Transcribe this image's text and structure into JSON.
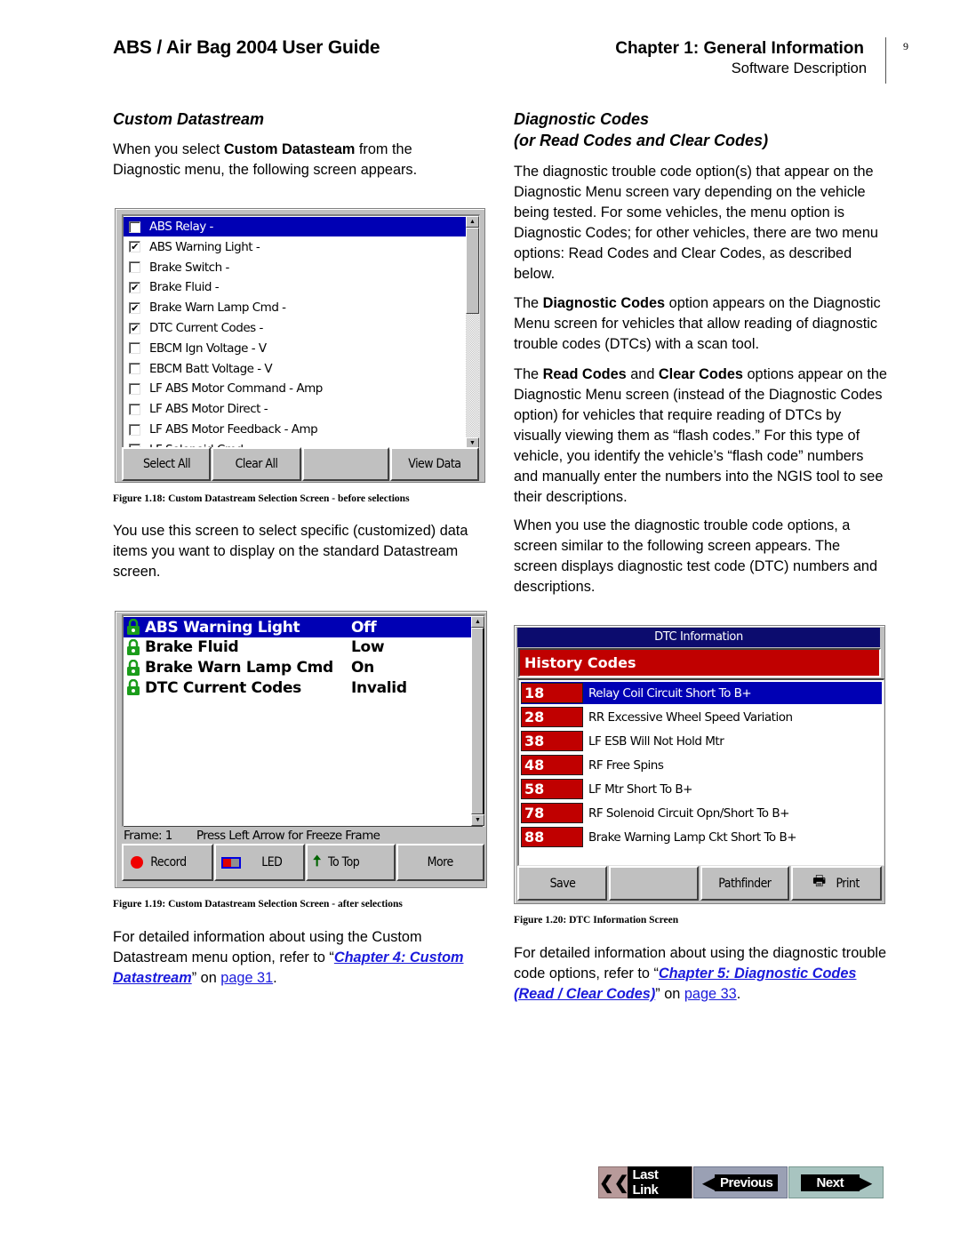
{
  "header": {
    "doc_title": "ABS / Air Bag 2004 User Guide",
    "chapter_title": "Chapter 1: General Information",
    "chapter_subtitle": "Software Description",
    "page_number": "9"
  },
  "left": {
    "heading": "Custom Datastream",
    "intro_pre": "When you select ",
    "intro_bold": "Custom Datasteam",
    "intro_post": " from the Diagnostic menu, the following screen appears.",
    "fig1": {
      "items": [
        {
          "label": "ABS Relay -",
          "checked": false,
          "selected": true
        },
        {
          "label": "ABS Warning Light -",
          "checked": true,
          "selected": false
        },
        {
          "label": "Brake Switch -",
          "checked": false,
          "selected": false
        },
        {
          "label": "Brake Fluid -",
          "checked": true,
          "selected": false
        },
        {
          "label": "Brake Warn Lamp Cmd -",
          "checked": true,
          "selected": false
        },
        {
          "label": "DTC Current Codes -",
          "checked": true,
          "selected": false
        },
        {
          "label": "EBCM Ign Voltage - V",
          "checked": false,
          "selected": false
        },
        {
          "label": "EBCM Batt Voltage - V",
          "checked": false,
          "selected": false
        },
        {
          "label": "LF ABS Motor Command - Amp",
          "checked": false,
          "selected": false
        },
        {
          "label": "LF ABS Motor Direct -",
          "checked": false,
          "selected": false
        },
        {
          "label": "LF ABS Motor Feedback - Amp",
          "checked": false,
          "selected": false
        },
        {
          "label": "LF Solenoid Cmd -",
          "checked": false,
          "selected": false
        }
      ],
      "buttons": [
        "Select All",
        "Clear All",
        "",
        "View Data"
      ],
      "caption": "Figure 1.18: Custom Datastream Selection Screen - before selections"
    },
    "para2": "You use this screen to select specific (customized) data items you want to display on the standard Datastream screen.",
    "fig2": {
      "rows": [
        {
          "name": "ABS Warning Light",
          "value": "Off",
          "selected": true
        },
        {
          "name": "Brake Fluid",
          "value": "Low",
          "selected": false
        },
        {
          "name": "Brake Warn Lamp Cmd",
          "value": "On",
          "selected": false
        },
        {
          "name": "DTC Current Codes",
          "value": "Invalid",
          "selected": false
        }
      ],
      "frame_label": "Frame: 1",
      "status_text": "Press Left Arrow for Freeze Frame",
      "buttons": {
        "record": "Record",
        "led": "LED",
        "to_top": "To Top",
        "more": "More"
      },
      "caption": "Figure 1.19: Custom Datastream Selection Screen - after selections"
    },
    "para3_pre": "For detailed information about using the Custom Datastream menu option, refer to “",
    "para3_link": "Chapter 4: Custom Datastream",
    "para3_mid": "” on ",
    "para3_page": "page 31",
    "para3_end": "."
  },
  "right": {
    "heading_line1": "Diagnostic Codes",
    "heading_line2": "(or Read Codes and Clear Codes)",
    "para1": "The diagnostic trouble code option(s) that appear on the Diagnostic Menu screen vary depending on the vehicle being tested. For some vehicles, the menu option is Diagnostic Codes; for other vehicles, there are two menu options: Read Codes and Clear Codes, as described below.",
    "para2_pre": "The ",
    "para2_bold": "Diagnostic Codes",
    "para2_post": " option appears on the Diagnostic Menu screen for vehicles that allow reading of diagnostic trouble codes (DTCs) with a scan tool.",
    "para3_pre": "The ",
    "para3_bold1": "Read Codes",
    "para3_mid": " and ",
    "para3_bold2": "Clear Codes",
    "para3_post": " options appear on the Diagnostic Menu screen (instead of the Diagnostic Codes option) for vehicles that require reading of DTCs by visually viewing them as “flash codes.” For this type of vehicle, you identify the vehicle’s “flash code” numbers and manually enter the numbers into the NGIS tool to see their descriptions.",
    "para4": "When you use the diagnostic trouble code options, a screen similar to the following screen appears. The screen displays diagnostic test code (DTC) numbers and descriptions.",
    "fig3": {
      "title": "DTC Information",
      "section": "History Codes",
      "codes": [
        {
          "code": "18",
          "desc": "Relay Coil Circuit Short To B+",
          "selected": true
        },
        {
          "code": "28",
          "desc": "RR Excessive Wheel Speed Variation",
          "selected": false
        },
        {
          "code": "38",
          "desc": "LF ESB Will Not Hold Mtr",
          "selected": false
        },
        {
          "code": "48",
          "desc": "RF Free Spins",
          "selected": false
        },
        {
          "code": "58",
          "desc": "LF Mtr Short To B+",
          "selected": false
        },
        {
          "code": "78",
          "desc": "RF Solenoid Circuit Opn/Short To B+",
          "selected": false
        },
        {
          "code": "88",
          "desc": "Brake Warning Lamp Ckt Short To B+",
          "selected": false
        }
      ],
      "buttons": {
        "save": "Save",
        "blank": "",
        "pathfinder": "Pathfinder",
        "print": "Print"
      },
      "caption": "Figure 1.20: DTC Information Screen"
    },
    "para5_pre": "For detailed information about using the diagnostic trouble code options, refer to “",
    "para5_link": "Chapter 5: Diagnostic Codes (Read / Clear Codes)",
    "para5_mid": "” on ",
    "para5_page": "page 33",
    "para5_end": "."
  },
  "nav": {
    "last_link": "Last Link",
    "previous": "Previous",
    "next": "Next"
  },
  "colors": {
    "selection_blue": "#0000b4",
    "dtc_red": "#c00000",
    "dtc_title_navy": "#0c0c6e",
    "link_blue": "#1a1adb",
    "lock_green": "#1a9c1a"
  }
}
